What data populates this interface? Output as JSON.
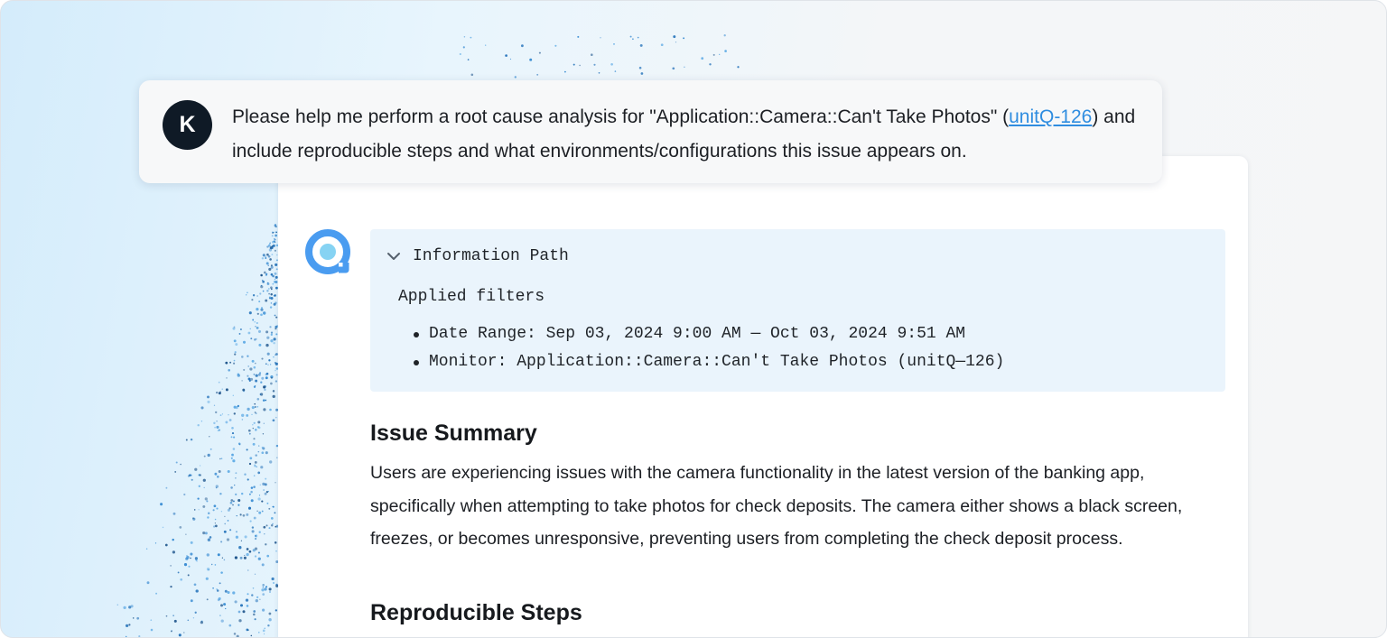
{
  "prompt": {
    "avatar_initial": "K",
    "text_before_link": "Please help me perform a root cause analysis for \"Application::Camera::Can't Take Photos\" (",
    "link_text": "unitQ-126",
    "text_after_link": ") and include reproducible steps and what environments/configurations this issue appears on."
  },
  "info_path": {
    "title": "Information Path",
    "filters_title": "Applied filters",
    "filters": [
      "Date Range: Sep 03, 2024 9:00 AM — Oct 03, 2024 9:51 AM",
      "Monitor: Application::Camera::Can't Take Photos (unitQ—126)"
    ]
  },
  "issue_summary": {
    "heading": "Issue Summary",
    "body": "Users are experiencing issues with the camera functionality in the latest version of the banking app, specifically when attempting to take photos for check deposits. The camera either shows a black screen, freezes, or becomes unresponsive, preventing users from completing the check deposit process."
  },
  "reproducible_steps": {
    "heading": "Reproducible Steps"
  },
  "icons": {
    "bot_logo": "bot-logo-icon",
    "chevron": "chevron-down-icon"
  },
  "colors": {
    "link": "#2f8de0",
    "avatar_bg": "#0f1a26",
    "info_bg": "#eaf4fc",
    "logo_ring": "#4a9cf0",
    "logo_center": "#86d3f3"
  }
}
